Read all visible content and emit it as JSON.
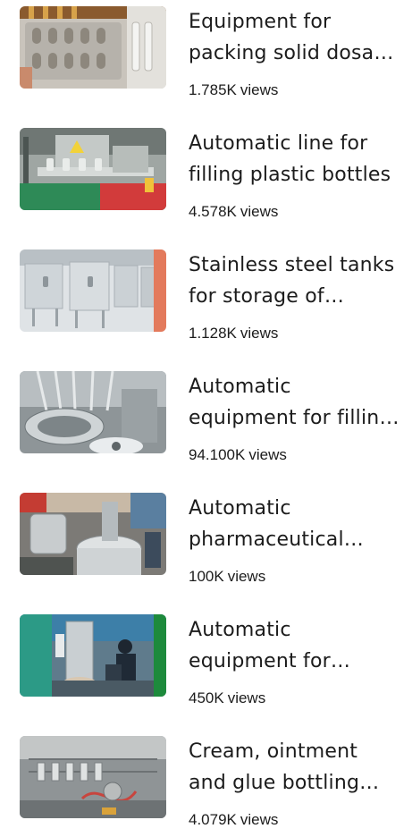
{
  "videos": [
    {
      "title": "Equipment for packing solid dosage forms",
      "views": "1.785K",
      "views_suffix": "views",
      "thumbnail_icon": "blister-pack-photo"
    },
    {
      "title": "Automatic line for filling plastic bottles",
      "views": "4.578K",
      "views_suffix": "views",
      "thumbnail_icon": "filling-line-photo"
    },
    {
      "title": "Stainless steel tanks for storage of products",
      "views": "1.128K",
      "views_suffix": "views",
      "thumbnail_icon": "steel-tanks-photo"
    },
    {
      "title": "Automatic equipment for filling vials",
      "views": "94.100K",
      "views_suffix": "views",
      "thumbnail_icon": "vial-filler-photo"
    },
    {
      "title": "Automatic pharmaceutical equipment",
      "views": "100K",
      "views_suffix": "views",
      "thumbnail_icon": "pharma-reactor-photo"
    },
    {
      "title": "Automatic equipment for production",
      "views": "450K",
      "views_suffix": "views",
      "thumbnail_icon": "production-hall-photo"
    },
    {
      "title": "Cream, ointment and glue bottling line",
      "views": "4.079K",
      "views_suffix": "views",
      "thumbnail_icon": "tube-filler-photo"
    }
  ]
}
